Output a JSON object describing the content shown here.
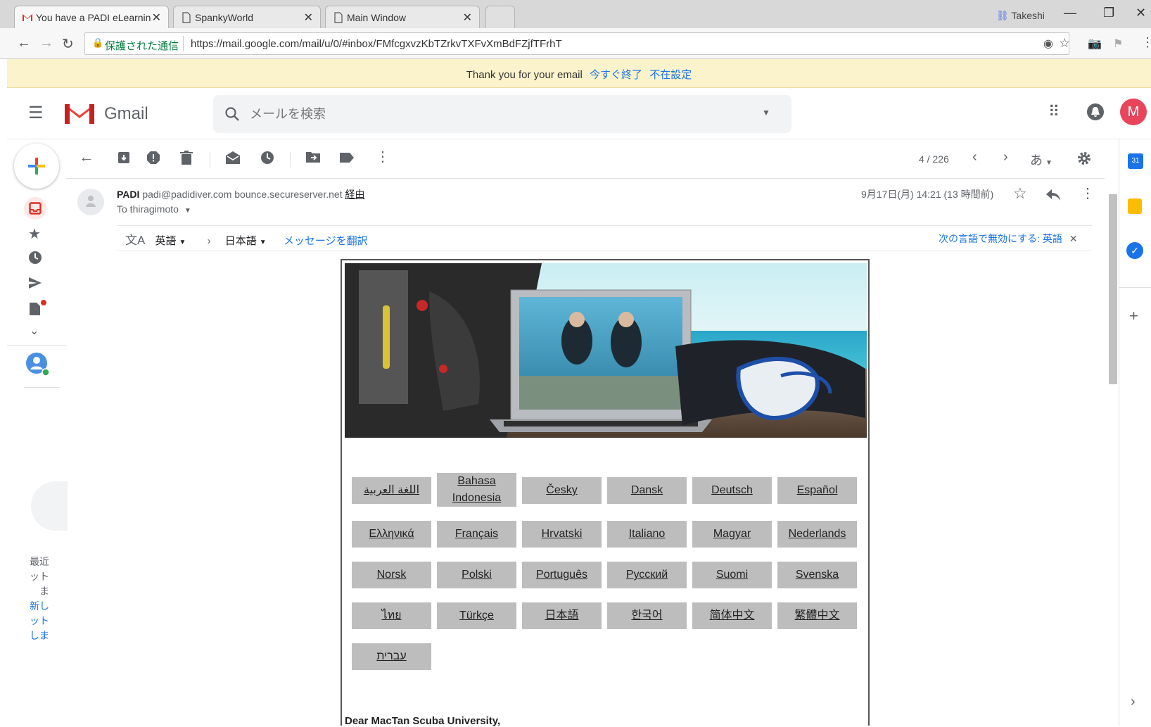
{
  "browser": {
    "tabs": [
      {
        "title": "You have a PADI eLearnin",
        "active": true
      },
      {
        "title": "SpankyWorld",
        "active": false
      },
      {
        "title": "Main Window",
        "active": false
      }
    ],
    "profile_name": "Takeshi",
    "secure_label": "保護された通信",
    "url": "https://mail.google.com/mail/u/0/#inbox/FMfcgxvzKbTZrkvTXFvXmBdFZjfTFrhT"
  },
  "notice": {
    "text": "Thank you for your email",
    "end_now": "今すぐ終了",
    "vacation_settings": "不在設定"
  },
  "gmail": {
    "logo_text": "Gmail",
    "search_placeholder": "メールを検索",
    "avatar_letter": "M",
    "colors": {
      "accent_red": "#ea4335",
      "avatar": "#e8445a",
      "link": "#1a73e8",
      "notice_bg": "#fbf3cc"
    }
  },
  "toolbar": {
    "page_count": "4 / 226",
    "input_tool": "あ"
  },
  "message": {
    "sender_name": "PADI",
    "sender_email": "padi@padidiver.com",
    "via_domain": "bounce.secureserver.net",
    "via_label": "経由",
    "to": "To thiragimoto",
    "date": "9月17日(月) 14:21 (13 時間前)"
  },
  "translate": {
    "from_lang": "英語",
    "to_lang": "日本語",
    "translate_link": "メッセージを翻訳",
    "disable_label": "次の言語で無効にする: 英語"
  },
  "languages": [
    "اللغة العربية",
    "Bahasa Indonesia",
    "Česky",
    "Dansk",
    "Deutsch",
    "Español",
    "Ελληνικά",
    "Français",
    "Hrvatski",
    "Italiano",
    "Magyar",
    "Nederlands",
    "Norsk",
    "Polski",
    "Português",
    "Русский",
    "Suomi",
    "Svenska",
    "ไทย",
    "Türkçe",
    "日本語",
    "한국어",
    "简体中文",
    "繁體中文",
    "עברית"
  ],
  "email_body": {
    "greeting": "Dear MacTan Scuba University,"
  },
  "hangouts_partial": {
    "line1": "最近",
    "line2": "ット",
    "line3": "ま",
    "link1": "新し",
    "link2": "ット",
    "link3": "しま"
  }
}
